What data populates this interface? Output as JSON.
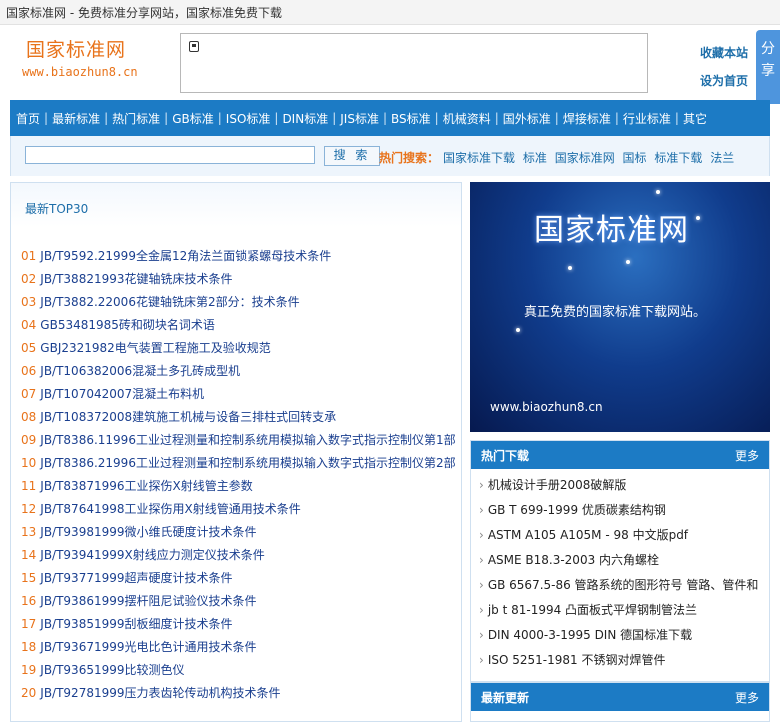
{
  "topbar": {
    "title": "国家标准网 - 免费标准分享网站，国家标准免费下载"
  },
  "header": {
    "logo_title": "国家标准网",
    "logo_url": "www.biaozhun8.cn",
    "favorite": "收藏本站",
    "set_home": "设为首页",
    "share": [
      "分",
      "享"
    ]
  },
  "nav": {
    "items": [
      "首页",
      "最新标准",
      "热门标准",
      "GB标准",
      "ISO标准",
      "DIN标准",
      "JIS标准",
      "BS标准",
      "机械资料",
      "国外标准",
      "焊接标准",
      "行业标准",
      "其它"
    ]
  },
  "search": {
    "placeholder": "",
    "button": "搜 索",
    "hot_label": "热门搜索：",
    "hot_links": [
      "国家标准下载",
      "标准",
      "国家标准网",
      "国标",
      "标准下载",
      "法兰"
    ]
  },
  "top30": {
    "title": "最新TOP30",
    "items": [
      {
        "num": "01",
        "title": "JB/T9592.21999全金属12角法兰面锁紧螺母技术条件"
      },
      {
        "num": "02",
        "title": "JB/T38821993花键轴铣床技术条件"
      },
      {
        "num": "03",
        "title": "JB/T3882.22006花键轴铣床第2部分：技术条件"
      },
      {
        "num": "04",
        "title": "GB53481985砖和砌块名词术语"
      },
      {
        "num": "05",
        "title": "GBJ2321982电气装置工程施工及验收规范"
      },
      {
        "num": "06",
        "title": "JB/T106382006混凝土多孔砖成型机"
      },
      {
        "num": "07",
        "title": "JB/T107042007混凝土布料机"
      },
      {
        "num": "08",
        "title": "JB/T108372008建筑施工机械与设备三排柱式回转支承"
      },
      {
        "num": "09",
        "title": "JB/T8386.11996工业过程测量和控制系统用模拟输入数字式指示控制仪第1部"
      },
      {
        "num": "10",
        "title": "JB/T8386.21996工业过程测量和控制系统用模拟输入数字式指示控制仪第2部"
      },
      {
        "num": "11",
        "title": "JB/T83871996工业探伤X射线管主参数"
      },
      {
        "num": "12",
        "title": "JB/T87641998工业探伤用X射线管通用技术条件"
      },
      {
        "num": "13",
        "title": "JB/T93981999微小维氏硬度计技术条件"
      },
      {
        "num": "14",
        "title": "JB/T93941999X射线应力测定仪技术条件"
      },
      {
        "num": "15",
        "title": "JB/T93771999超声硬度计技术条件"
      },
      {
        "num": "16",
        "title": "JB/T93861999摆杆阻尼试验仪技术条件"
      },
      {
        "num": "17",
        "title": "JB/T93851999刮板细度计技术条件"
      },
      {
        "num": "18",
        "title": "JB/T93671999光电比色计通用技术条件"
      },
      {
        "num": "19",
        "title": "JB/T93651999比较测色仪"
      },
      {
        "num": "20",
        "title": "JB/T92781999压力表齿轮传动机构技术条件"
      }
    ]
  },
  "banner": {
    "title": "国家标准网",
    "slogan": "真正免费的国家标准下载网站。",
    "url": "www.biaozhun8.cn"
  },
  "hot_downloads": {
    "title": "热门下载",
    "more": "更多",
    "items": [
      "机械设计手册2008破解版",
      "GB T 699-1999 优质碳素结构钢",
      "ASTM A105 A105M - 98 中文版pdf",
      "ASME B18.3-2003 内六角螺栓",
      "GB 6567.5-86 管路系统的图形符号 管路、管件和",
      "jb t 81-1994 凸面板式平焊钢制管法兰",
      "DIN 4000-3-1995 DIN 德国标准下载",
      "ISO 5251-1981 不锈钢对焊管件"
    ]
  },
  "latest_updates": {
    "title": "最新更新",
    "more": "更多"
  }
}
